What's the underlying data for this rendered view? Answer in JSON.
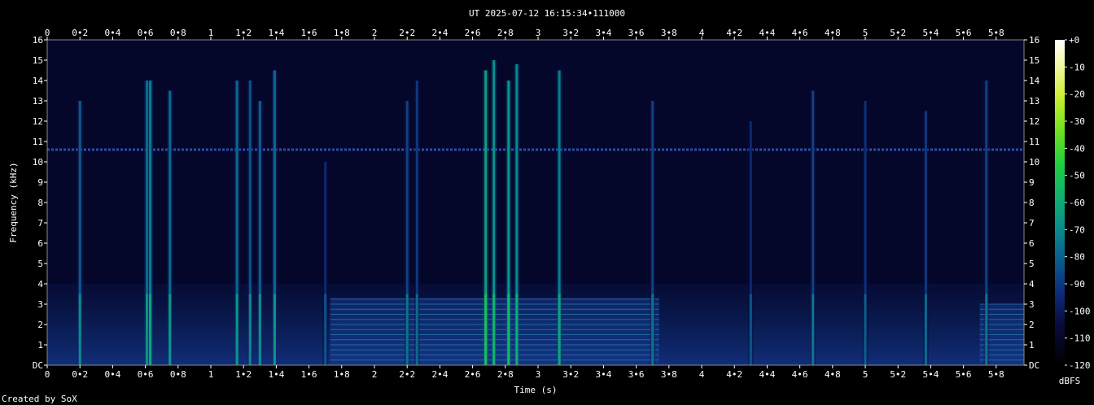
{
  "chart_data": {
    "type": "heatmap",
    "title": "UT 2025-07-12 16:15:34•111000",
    "xlabel": "Time (s)",
    "ylabel": "Frequency (kHz)",
    "xlim": [
      0,
      5.97
    ],
    "ylim": [
      0,
      16
    ],
    "x_ticks": [
      "0",
      "0•2",
      "0•4",
      "0•6",
      "0•8",
      "1",
      "1•2",
      "1•4",
      "1•6",
      "1•8",
      "2",
      "2•2",
      "2•4",
      "2•6",
      "2•8",
      "3",
      "3•2",
      "3•4",
      "3•6",
      "3•8",
      "4",
      "4•2",
      "4•4",
      "4•6",
      "4•8",
      "5",
      "5•2",
      "5•4",
      "5•6",
      "5•8"
    ],
    "y_ticks": [
      "DC",
      "1",
      "2",
      "3",
      "4",
      "5",
      "6",
      "7",
      "8",
      "9",
      "10",
      "11",
      "12",
      "13",
      "14",
      "15",
      "16"
    ],
    "colorbar": {
      "label": "dBFS",
      "ticks": [
        "+0",
        "-10",
        "-20",
        "-30",
        "-40",
        "-50",
        "-60",
        "-70",
        "-80",
        "-90",
        "-100",
        "-110",
        "-120"
      ],
      "range": [
        -120,
        0
      ]
    },
    "features": {
      "hum_line_khz": 10.6,
      "low_band_khz": [
        0,
        4
      ],
      "harmonic_blocks": [
        {
          "t_start": 1.73,
          "t_end": 3.74,
          "f_top_khz": 3.3
        },
        {
          "t_start": 5.7,
          "t_end": 5.97,
          "f_top_khz": 3.0
        }
      ],
      "transients": [
        {
          "t": 0.2,
          "f_top": 13,
          "level": -85
        },
        {
          "t": 0.61,
          "f_top": 14,
          "level": -80
        },
        {
          "t": 0.63,
          "f_top": 14,
          "level": -78
        },
        {
          "t": 0.75,
          "f_top": 13.5,
          "level": -82
        },
        {
          "t": 1.16,
          "f_top": 14,
          "level": -82
        },
        {
          "t": 1.24,
          "f_top": 14,
          "level": -86
        },
        {
          "t": 1.3,
          "f_top": 13,
          "level": -84
        },
        {
          "t": 1.39,
          "f_top": 14.5,
          "level": -82
        },
        {
          "t": 1.7,
          "f_top": 10,
          "level": -96
        },
        {
          "t": 2.2,
          "f_top": 13,
          "level": -90
        },
        {
          "t": 2.26,
          "f_top": 14,
          "level": -92
        },
        {
          "t": 2.68,
          "f_top": 14.5,
          "level": -70
        },
        {
          "t": 2.73,
          "f_top": 15,
          "level": -74
        },
        {
          "t": 2.82,
          "f_top": 14,
          "level": -72
        },
        {
          "t": 2.87,
          "f_top": 14.8,
          "level": -76
        },
        {
          "t": 3.13,
          "f_top": 14.5,
          "level": -78
        },
        {
          "t": 3.7,
          "f_top": 13,
          "level": -90
        },
        {
          "t": 4.3,
          "f_top": 12,
          "level": -96
        },
        {
          "t": 4.68,
          "f_top": 13.5,
          "level": -90
        },
        {
          "t": 5.0,
          "f_top": 13,
          "level": -94
        },
        {
          "t": 5.37,
          "f_top": 12.5,
          "level": -92
        },
        {
          "t": 5.74,
          "f_top": 14,
          "level": -90
        }
      ]
    },
    "grid": false
  },
  "footer": {
    "credit": "Created by SoX"
  },
  "colors": {
    "background": "#000000",
    "text": "#ffffff",
    "axis": "#ffffff"
  }
}
